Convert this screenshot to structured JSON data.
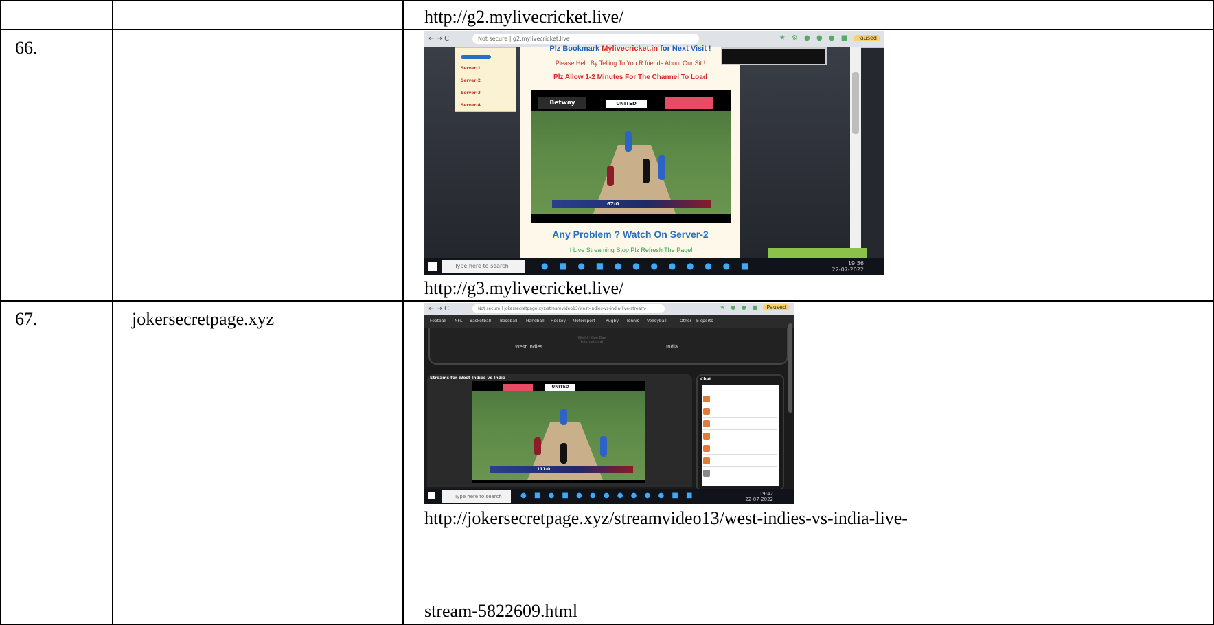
{
  "rows": [
    {
      "top_url": "http://g2.mylivecricket.live/",
      "number": "66.",
      "site": "",
      "bottom_url": "http://g3.mylivecricket.live/",
      "screenshot": {
        "address": "Not secure | g2.mylivecricket.live",
        "server_menu": [
          "Server-1",
          "Server-2",
          "Server-3",
          "Server-4"
        ],
        "headline": "Plz Bookmark Mylivecricket.in for Next Visit !",
        "headline_brand": "Mylivecricket.in",
        "notice1": "Please Help By Telling To You R friends About Our Sit !",
        "notice2": "Plz Allow 1-2 Minutes For The Channel To Load",
        "problem": "Any Problem ? Watch On Server-2",
        "refresh": "If Live Streaming Stop Plz Refresh The Page!",
        "video_banner_mid": "UNITED",
        "video_banner_left": "Betway",
        "score": "67-0",
        "taskbar_search": "Type here to search",
        "clock_time": "19:56",
        "clock_date": "22-07-2022"
      }
    },
    {
      "number": "67.",
      "site": "jokersecretpage.xyz",
      "bottom_url_line1": "http://jokersecretpage.xyz/streamvideo13/west-indies-vs-india-live-",
      "bottom_url_line2": "stream-5822609.html",
      "screenshot": {
        "address": "Not secure | jokersecretpage.xyz/streamvideo13/west-indies-vs-india-live-stream-5822609.html",
        "nav": [
          "Football",
          "NFL",
          "Basketball",
          "Baseball",
          "Handball",
          "Hockey",
          "Motorsport",
          "Rugby",
          "Tennis",
          "Volleyball",
          "Other",
          "E-sports"
        ],
        "team_left": "West Indies",
        "team_right": "India",
        "match_type": "World - One Day International",
        "streams_title": "Streams for West Indies vs India",
        "chat_title": "Chat",
        "video_banner_mid": "UNITED",
        "score": "111-0",
        "taskbar_search": "Type here to search",
        "clock_time": "19:42",
        "clock_date": "22-07-2022"
      }
    }
  ],
  "colors": {
    "headline_blue": "#1d5fb4",
    "brand_red": "#d52b2b",
    "problem_blue": "#2a6fc2",
    "refresh_green": "#2aa84a",
    "green_tab": "#8bc34a",
    "dark_bg": "#1b1b1b"
  }
}
